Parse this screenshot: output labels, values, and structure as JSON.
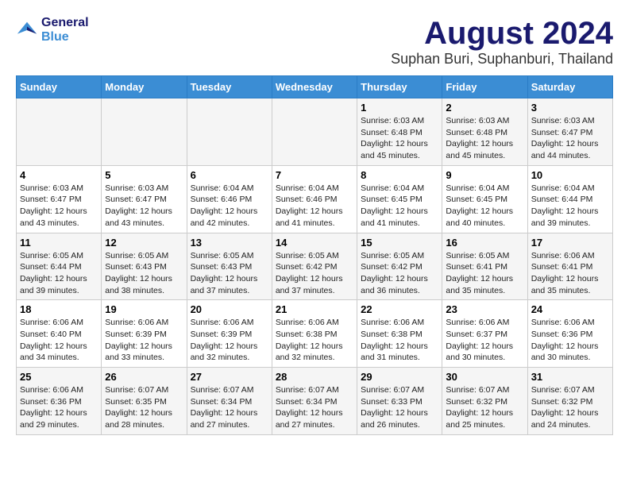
{
  "logo": {
    "line1": "General",
    "line2": "Blue"
  },
  "title": "August 2024",
  "location": "Suphan Buri, Suphanburi, Thailand",
  "days_of_week": [
    "Sunday",
    "Monday",
    "Tuesday",
    "Wednesday",
    "Thursday",
    "Friday",
    "Saturday"
  ],
  "weeks": [
    [
      {
        "day": "",
        "info": ""
      },
      {
        "day": "",
        "info": ""
      },
      {
        "day": "",
        "info": ""
      },
      {
        "day": "",
        "info": ""
      },
      {
        "day": "1",
        "info": "Sunrise: 6:03 AM\nSunset: 6:48 PM\nDaylight: 12 hours\nand 45 minutes."
      },
      {
        "day": "2",
        "info": "Sunrise: 6:03 AM\nSunset: 6:48 PM\nDaylight: 12 hours\nand 45 minutes."
      },
      {
        "day": "3",
        "info": "Sunrise: 6:03 AM\nSunset: 6:47 PM\nDaylight: 12 hours\nand 44 minutes."
      }
    ],
    [
      {
        "day": "4",
        "info": "Sunrise: 6:03 AM\nSunset: 6:47 PM\nDaylight: 12 hours\nand 43 minutes."
      },
      {
        "day": "5",
        "info": "Sunrise: 6:03 AM\nSunset: 6:47 PM\nDaylight: 12 hours\nand 43 minutes."
      },
      {
        "day": "6",
        "info": "Sunrise: 6:04 AM\nSunset: 6:46 PM\nDaylight: 12 hours\nand 42 minutes."
      },
      {
        "day": "7",
        "info": "Sunrise: 6:04 AM\nSunset: 6:46 PM\nDaylight: 12 hours\nand 41 minutes."
      },
      {
        "day": "8",
        "info": "Sunrise: 6:04 AM\nSunset: 6:45 PM\nDaylight: 12 hours\nand 41 minutes."
      },
      {
        "day": "9",
        "info": "Sunrise: 6:04 AM\nSunset: 6:45 PM\nDaylight: 12 hours\nand 40 minutes."
      },
      {
        "day": "10",
        "info": "Sunrise: 6:04 AM\nSunset: 6:44 PM\nDaylight: 12 hours\nand 39 minutes."
      }
    ],
    [
      {
        "day": "11",
        "info": "Sunrise: 6:05 AM\nSunset: 6:44 PM\nDaylight: 12 hours\nand 39 minutes."
      },
      {
        "day": "12",
        "info": "Sunrise: 6:05 AM\nSunset: 6:43 PM\nDaylight: 12 hours\nand 38 minutes."
      },
      {
        "day": "13",
        "info": "Sunrise: 6:05 AM\nSunset: 6:43 PM\nDaylight: 12 hours\nand 37 minutes."
      },
      {
        "day": "14",
        "info": "Sunrise: 6:05 AM\nSunset: 6:42 PM\nDaylight: 12 hours\nand 37 minutes."
      },
      {
        "day": "15",
        "info": "Sunrise: 6:05 AM\nSunset: 6:42 PM\nDaylight: 12 hours\nand 36 minutes."
      },
      {
        "day": "16",
        "info": "Sunrise: 6:05 AM\nSunset: 6:41 PM\nDaylight: 12 hours\nand 35 minutes."
      },
      {
        "day": "17",
        "info": "Sunrise: 6:06 AM\nSunset: 6:41 PM\nDaylight: 12 hours\nand 35 minutes."
      }
    ],
    [
      {
        "day": "18",
        "info": "Sunrise: 6:06 AM\nSunset: 6:40 PM\nDaylight: 12 hours\nand 34 minutes."
      },
      {
        "day": "19",
        "info": "Sunrise: 6:06 AM\nSunset: 6:39 PM\nDaylight: 12 hours\nand 33 minutes."
      },
      {
        "day": "20",
        "info": "Sunrise: 6:06 AM\nSunset: 6:39 PM\nDaylight: 12 hours\nand 32 minutes."
      },
      {
        "day": "21",
        "info": "Sunrise: 6:06 AM\nSunset: 6:38 PM\nDaylight: 12 hours\nand 32 minutes."
      },
      {
        "day": "22",
        "info": "Sunrise: 6:06 AM\nSunset: 6:38 PM\nDaylight: 12 hours\nand 31 minutes."
      },
      {
        "day": "23",
        "info": "Sunrise: 6:06 AM\nSunset: 6:37 PM\nDaylight: 12 hours\nand 30 minutes."
      },
      {
        "day": "24",
        "info": "Sunrise: 6:06 AM\nSunset: 6:36 PM\nDaylight: 12 hours\nand 30 minutes."
      }
    ],
    [
      {
        "day": "25",
        "info": "Sunrise: 6:06 AM\nSunset: 6:36 PM\nDaylight: 12 hours\nand 29 minutes."
      },
      {
        "day": "26",
        "info": "Sunrise: 6:07 AM\nSunset: 6:35 PM\nDaylight: 12 hours\nand 28 minutes."
      },
      {
        "day": "27",
        "info": "Sunrise: 6:07 AM\nSunset: 6:34 PM\nDaylight: 12 hours\nand 27 minutes."
      },
      {
        "day": "28",
        "info": "Sunrise: 6:07 AM\nSunset: 6:34 PM\nDaylight: 12 hours\nand 27 minutes."
      },
      {
        "day": "29",
        "info": "Sunrise: 6:07 AM\nSunset: 6:33 PM\nDaylight: 12 hours\nand 26 minutes."
      },
      {
        "day": "30",
        "info": "Sunrise: 6:07 AM\nSunset: 6:32 PM\nDaylight: 12 hours\nand 25 minutes."
      },
      {
        "day": "31",
        "info": "Sunrise: 6:07 AM\nSunset: 6:32 PM\nDaylight: 12 hours\nand 24 minutes."
      }
    ]
  ]
}
